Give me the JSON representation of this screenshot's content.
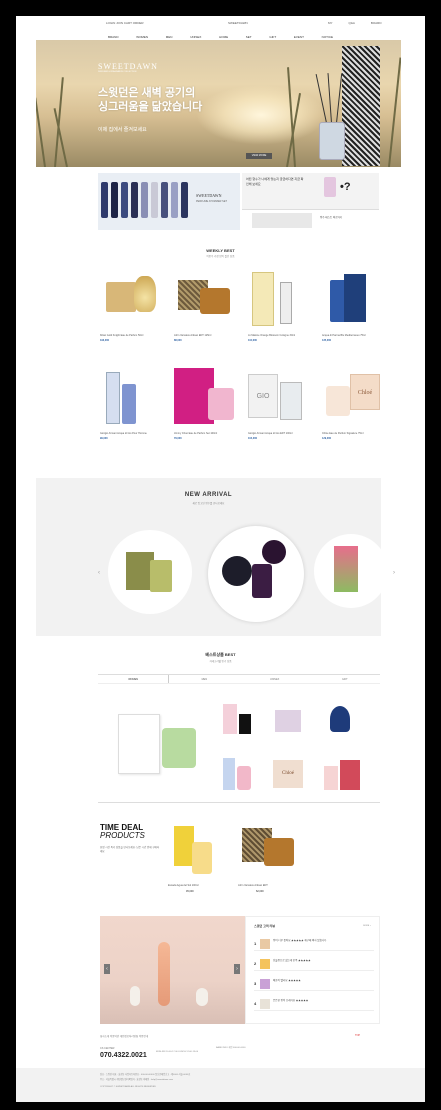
{
  "topbar": {
    "left": "LOGIN  JOIN  CART  ORDER",
    "center": "SWEETDAWN",
    "right": [
      "MY",
      "Q&A",
      "BOARD"
    ]
  },
  "nav": [
    "BRAND",
    "WOMEN",
    "MEN",
    "UNISEX",
    "HOME",
    "SET",
    "GIFT",
    "EVENT",
    "NOTICE"
  ],
  "hero": {
    "brand": "SWEETDAWN",
    "brand_sub": "DIFFUSER & FRAGRANCE COLLECTION",
    "headline_1": "스윗던은 새벽 공기의",
    "headline_2": "싱그러움을 닮았습니다",
    "subtext": "이제 집에서 즐겨보세요",
    "button": "VIEW MORE"
  },
  "promo_left": {
    "brand": "SWEETDAWN",
    "sub": "PERFUME ATOMIZER SET"
  },
  "promo_right": {
    "text": "어떤 향수가 나에게 맞는지 궁금하다면 지금 확인해 보세요",
    "strip": "향수 테스트 바로가기"
  },
  "best": {
    "title": "WEEKLY BEST",
    "sub": "이번주 가장 많이 팔린 상품"
  },
  "products": [
    {
      "name": "Kilian Gold Knight Eau de Parfum 50ml",
      "price": "193,000"
    },
    {
      "name": "John Varvatos Artisan EDT 125ml",
      "price": "88,000"
    },
    {
      "name": "Jo Malone Orange Blossom Cologne 30ml",
      "price": "110,000"
    },
    {
      "name": "Acqua di Parma Blu Mediterraneo 75ml",
      "price": "135,000"
    },
    {
      "name": "Giorgio Armani Acqua di Gio Pour Homme",
      "price": "99,000"
    },
    {
      "name": "Jimmy Choo Eau de Parfum Set 100ml",
      "price": "79,000"
    },
    {
      "name": "Giorgio Armani Acqua di Gio EDT 100ml",
      "price": "104,000"
    },
    {
      "name": "Chloe Eau de Parfum Signature 75ml",
      "price": "129,000"
    }
  ],
  "new_arrival": {
    "title": "NEW ARRIVAL",
    "sub": "새로 입고된 향수를 만나보세요"
  },
  "best_pick": {
    "title": "베스트상품 BEST",
    "sub": "카테고리별 인기 상품",
    "tabs": [
      "WOMEN",
      "MEN",
      "UNISEX",
      "GIFT"
    ]
  },
  "time_deal": {
    "title_1": "TIME DEAL",
    "title_2": "PRODUCTS",
    "sub": "한정 시간 특가 상품을 만나보세요. 남은 시간 안에 구매하세요",
    "items": [
      {
        "name": "Escada Agua del Sol 100ml",
        "price": "45,000"
      },
      {
        "name": "John Varvatos Artisan EDT",
        "price": "62,000"
      }
    ]
  },
  "review": {
    "head": "스윗던 고객 리뷰",
    "more": "MORE +",
    "rows": [
      {
        "n": "1",
        "t": "향이 너무 좋아요 ★★★★★ 재구매 의사 있습니다"
      },
      {
        "n": "2",
        "t": "선물용으로 샀는데 만족 ★★★★★"
      },
      {
        "n": "3",
        "t": "배송이 빨라요 ★★★★★"
      },
      {
        "n": "4",
        "t": "은은한 향이 오래가요 ★★★★★"
      }
    ]
  },
  "footer": {
    "links": "회사소개  이용약관  개인정보처리방침  이용안내",
    "right": "TOP",
    "cs": "CS CENTER",
    "phone": "070.4322.0021",
    "hours": "MON-FRI 10:00-17:00 LUNCH 12:00-13:00",
    "bank": "BANK INFO  국민 000-00-0000",
    "line1": "상호 : 스윗던  대표 : 홍길동  사업자등록번호 : 000-00-00000  통신판매업신고 : 제0000-서울-0000호",
    "line2": "주소 : 서울특별시  개인정보관리책임자 : 홍길동  이메일 : help@sweetdawn.com",
    "line3": "COPYRIGHT © SWEETDAWN ALL RIGHTS RESERVED"
  }
}
